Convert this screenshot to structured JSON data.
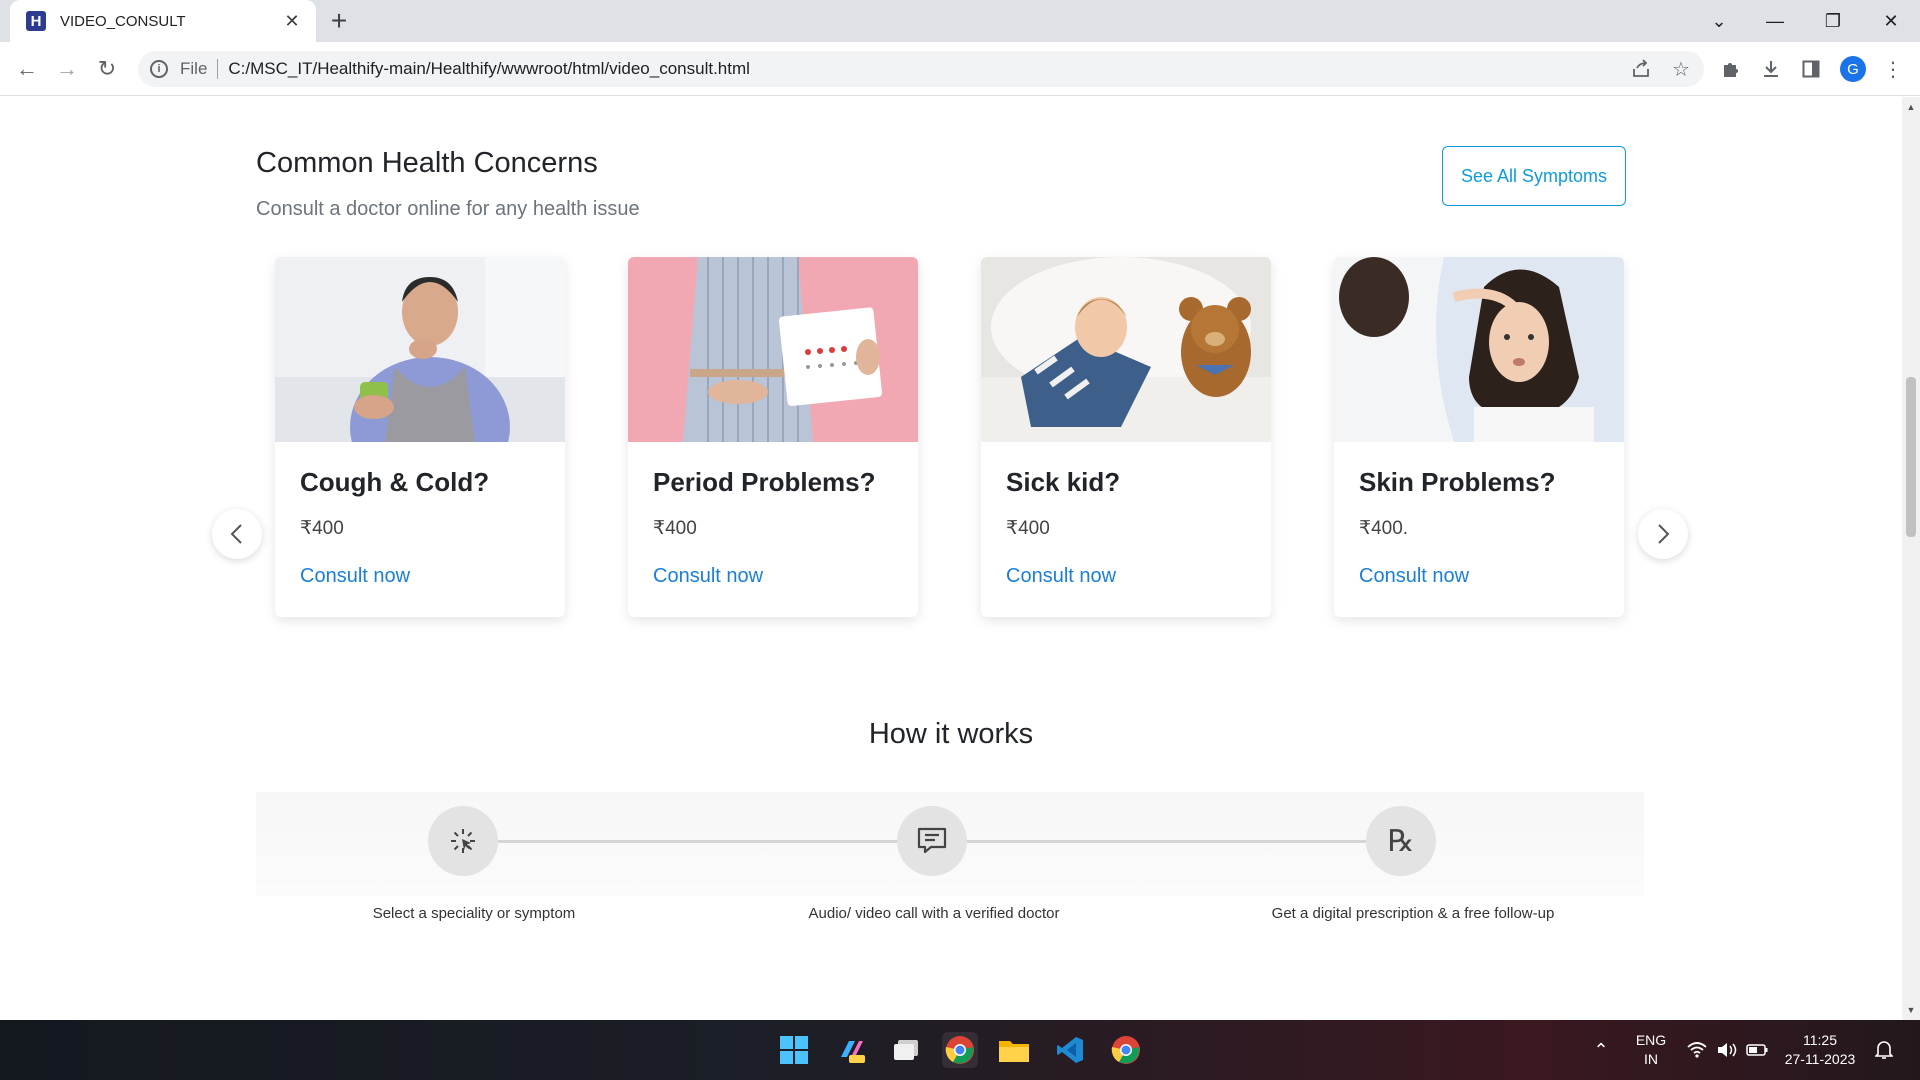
{
  "browser": {
    "tab_title": "VIDEO_CONSULT",
    "tab_favicon": "H",
    "file_label": "File",
    "url": "C:/MSC_IT/Healthify-main/Healthify/wwwroot/html/video_consult.html",
    "profile_initial": "G"
  },
  "concerns": {
    "title": "Common Health Concerns",
    "subtitle": "Consult a doctor online for any health issue",
    "see_all_label": "See All Symptoms",
    "cards": [
      {
        "title": "Cough & Cold?",
        "price": "₹400",
        "link": "Consult now"
      },
      {
        "title": "Period Problems?",
        "price": "₹400",
        "link": "Consult now"
      },
      {
        "title": "Sick kid?",
        "price": "₹400",
        "link": "Consult now"
      },
      {
        "title": "Skin Problems?",
        "price": "₹400.",
        "link": "Consult now"
      }
    ]
  },
  "how": {
    "title": "How it works",
    "steps": [
      {
        "label": "Select a speciality or symptom",
        "icon": "cursor-click-icon"
      },
      {
        "label": "Audio/ video call with a verified doctor",
        "icon": "chat-icon"
      },
      {
        "label": "Get a digital prescription & a free follow-up",
        "icon": "prescription-icon"
      }
    ]
  },
  "taskbar": {
    "lang_top": "ENG",
    "lang_bottom": "IN",
    "time": "11:25",
    "date": "27-11-2023"
  },
  "colors": {
    "accent_link": "#1a7fd6",
    "see_all_border": "#0d9bd9"
  }
}
